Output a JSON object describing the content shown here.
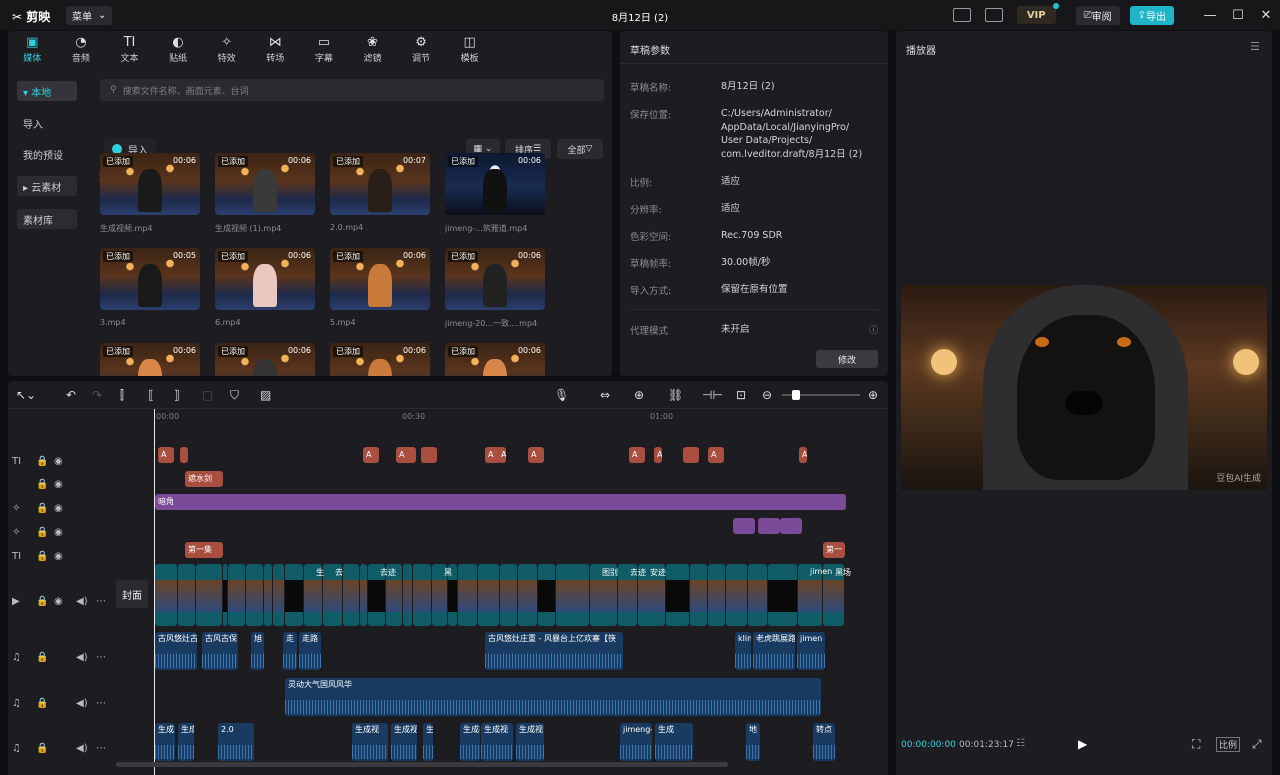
{
  "titlebar": {
    "logo": "✂ 剪映",
    "menu": "菜单",
    "title": "8月12日 (2)",
    "vip": "VIP",
    "review": "审阅",
    "export": "导出"
  },
  "media_tabs": [
    {
      "icon": "▣",
      "label": "媒体"
    },
    {
      "icon": "◔",
      "label": "音频"
    },
    {
      "icon": "TI",
      "label": "文本"
    },
    {
      "icon": "◐",
      "label": "贴纸"
    },
    {
      "icon": "✧",
      "label": "特效"
    },
    {
      "icon": "⋈",
      "label": "转场"
    },
    {
      "icon": "▭",
      "label": "字幕"
    },
    {
      "icon": "❀",
      "label": "滤镜"
    },
    {
      "icon": "⚙",
      "label": "调节"
    },
    {
      "icon": "◫",
      "label": "模板"
    }
  ],
  "sidebar": {
    "local": "▾ 本地",
    "import": "导入",
    "my_presets": "我的预设",
    "cloud": "▸ 云素材",
    "library": "素材库"
  },
  "search": {
    "placeholder": "搜索文件名称、画面元素、台词"
  },
  "media": {
    "import_label": "导入",
    "sort": "排序",
    "all_filter": "全部",
    "all_heading": "全部",
    "added": "已添加",
    "items": [
      {
        "name": "生成视频.mp4",
        "duration": "00:06",
        "scene": "warm",
        "fig": "#1a1a1a"
      },
      {
        "name": "生成视频 (1).mp4",
        "duration": "00:06",
        "scene": "warm",
        "fig": "#3a3a3a"
      },
      {
        "name": "2.0.mp4",
        "duration": "00:07",
        "scene": "warm",
        "fig": "#2a1e18"
      },
      {
        "name": "jimeng-...筑雅道.mp4",
        "duration": "00:06",
        "scene": "night",
        "fig": "#111"
      },
      {
        "name": "3.mp4",
        "duration": "00:05",
        "scene": "warm",
        "fig": "#1a1a1a"
      },
      {
        "name": "6.mp4",
        "duration": "00:06",
        "scene": "warm",
        "fig": "#e8c8c0"
      },
      {
        "name": "5.mp4",
        "duration": "00:06",
        "scene": "warm",
        "fig": "#c97a3a"
      },
      {
        "name": "jimeng-20...一致....mp4",
        "duration": "00:06",
        "scene": "warm",
        "fig": "#222"
      },
      {
        "name": "",
        "duration": "00:06",
        "scene": "warm",
        "fig": "#d8864a"
      },
      {
        "name": "",
        "duration": "00:06",
        "scene": "warm",
        "fig": "#333"
      },
      {
        "name": "",
        "duration": "00:06",
        "scene": "warm",
        "fig": "#c97a3a"
      },
      {
        "name": "",
        "duration": "00:06",
        "scene": "warm",
        "fig": "#d8864a"
      }
    ]
  },
  "draft": {
    "title": "草稿参数",
    "rows": [
      {
        "label": "草稿名称:",
        "value": "8月12日 (2)"
      },
      {
        "label": "保存位置:",
        "value": "C:/Users/Administrator/\nAppData/Local/JianyingPro/\nUser Data/Projects/\ncom.lveditor.draft/8月12日 (2)"
      },
      {
        "label": "比例:",
        "value": "适应"
      },
      {
        "label": "分辨率:",
        "value": "适应"
      },
      {
        "label": "色彩空间:",
        "value": "Rec.709 SDR"
      },
      {
        "label": "草稿帧率:",
        "value": "30.00帧/秒"
      },
      {
        "label": "导入方式:",
        "value": "保留在原有位置"
      },
      {
        "label": "代理模式",
        "value": "未开启"
      }
    ],
    "modify": "修改"
  },
  "player": {
    "title": "播放器",
    "current": "00:00:00:00",
    "total": "00:01:23:17",
    "ratio": "比例",
    "watermark": "豆包AI生成"
  },
  "timeline": {
    "ruler": [
      "00:00",
      "00:30",
      "01:00"
    ],
    "cover": "封面",
    "text_clips_1": [
      "A",
      "",
      "A",
      "A",
      "",
      "",
      "A",
      "A",
      "A",
      "A",
      "A",
      "",
      "A",
      "A"
    ],
    "subtitle_2": "遮水剑",
    "effect_main": "暗角",
    "fx_small": [
      "",
      "",
      ""
    ],
    "title_row": [
      "第一集",
      "第一"
    ],
    "video_labels": [
      "生",
      "去",
      "去迹",
      "黑",
      "图别",
      "去迹",
      "安迹",
      "jimen",
      "黑场"
    ],
    "audio1": [
      "古风悠灶古",
      "古风古保",
      "旭",
      "走",
      "走路",
      "古风悠灶庄重 - 风暴台上亿欢寨【筷",
      "klin",
      "老虎跳展路",
      "jimen"
    ],
    "audio2": "灵动大气国风风华",
    "audio3": [
      "生成",
      "生成",
      "2.0",
      "生成视",
      "生成视",
      "生成",
      "生成视",
      "生成视",
      "生成视",
      "jimeng-",
      "生成",
      "地",
      "转点"
    ]
  },
  "colors": {
    "accent": "#2fd1e0",
    "text_clip": "#a84f3f",
    "effect_clip": "#7b4a98",
    "video_clip": "#0f5b66",
    "audio_clip": "#193b62"
  }
}
